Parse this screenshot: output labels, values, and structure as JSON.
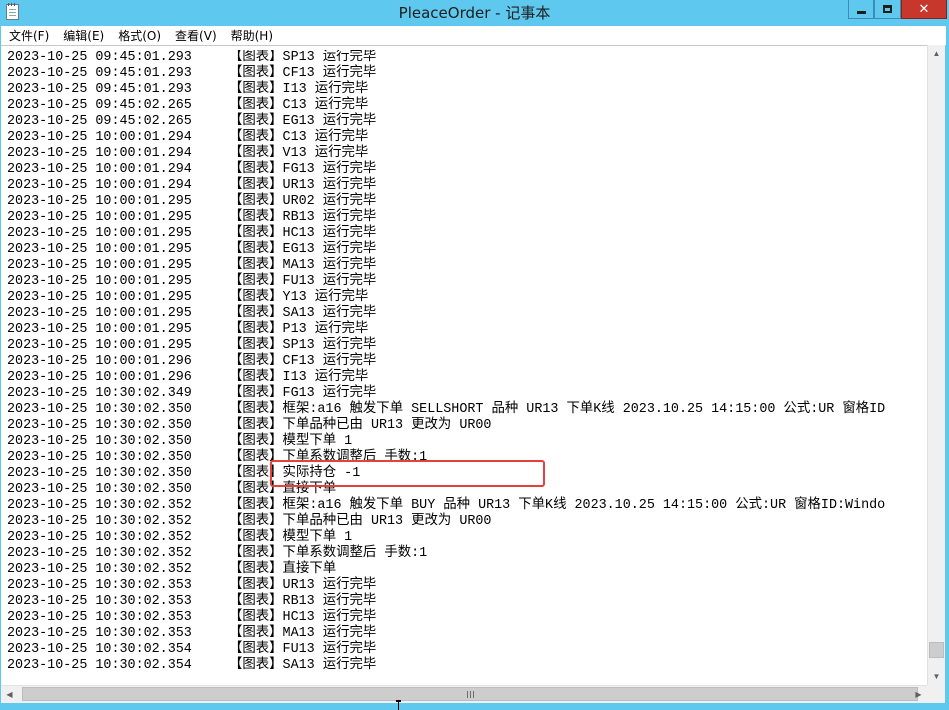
{
  "window": {
    "title": "PleaceOrder - 记事本",
    "icons": {
      "app": "notepad-icon",
      "minimize": "minimize-icon",
      "maximize": "maximize-icon",
      "close": "close-icon"
    }
  },
  "menu": [
    {
      "label": "文件(F)"
    },
    {
      "label": "编辑(E)"
    },
    {
      "label": "格式(O)"
    },
    {
      "label": "查看(V)"
    },
    {
      "label": "帮助(H)"
    }
  ],
  "colors": {
    "titlebar": "#5ec8ee",
    "close": "#c7372c",
    "highlight": "#e3413b"
  },
  "lines": [
    {
      "ts": "2023-10-25 09:45:01.293",
      "msg": "【图表】SP13 运行完毕"
    },
    {
      "ts": "2023-10-25 09:45:01.293",
      "msg": "【图表】CF13 运行完毕"
    },
    {
      "ts": "2023-10-25 09:45:01.293",
      "msg": "【图表】I13 运行完毕"
    },
    {
      "ts": "2023-10-25 09:45:02.265",
      "msg": "【图表】C13 运行完毕"
    },
    {
      "ts": "2023-10-25 09:45:02.265",
      "msg": "【图表】EG13 运行完毕"
    },
    {
      "ts": "2023-10-25 10:00:01.294",
      "msg": "【图表】C13 运行完毕"
    },
    {
      "ts": "2023-10-25 10:00:01.294",
      "msg": "【图表】V13 运行完毕"
    },
    {
      "ts": "2023-10-25 10:00:01.294",
      "msg": "【图表】FG13 运行完毕"
    },
    {
      "ts": "2023-10-25 10:00:01.294",
      "msg": "【图表】UR13 运行完毕"
    },
    {
      "ts": "2023-10-25 10:00:01.295",
      "msg": "【图表】UR02 运行完毕"
    },
    {
      "ts": "2023-10-25 10:00:01.295",
      "msg": "【图表】RB13 运行完毕"
    },
    {
      "ts": "2023-10-25 10:00:01.295",
      "msg": "【图表】HC13 运行完毕"
    },
    {
      "ts": "2023-10-25 10:00:01.295",
      "msg": "【图表】EG13 运行完毕"
    },
    {
      "ts": "2023-10-25 10:00:01.295",
      "msg": "【图表】MA13 运行完毕"
    },
    {
      "ts": "2023-10-25 10:00:01.295",
      "msg": "【图表】FU13 运行完毕"
    },
    {
      "ts": "2023-10-25 10:00:01.295",
      "msg": "【图表】Y13 运行完毕"
    },
    {
      "ts": "2023-10-25 10:00:01.295",
      "msg": "【图表】SA13 运行完毕"
    },
    {
      "ts": "2023-10-25 10:00:01.295",
      "msg": "【图表】P13 运行完毕"
    },
    {
      "ts": "2023-10-25 10:00:01.295",
      "msg": "【图表】SP13 运行完毕"
    },
    {
      "ts": "2023-10-25 10:00:01.296",
      "msg": "【图表】CF13 运行完毕"
    },
    {
      "ts": "2023-10-25 10:00:01.296",
      "msg": "【图表】I13 运行完毕"
    },
    {
      "ts": "2023-10-25 10:30:02.349",
      "msg": "【图表】FG13 运行完毕"
    },
    {
      "ts": "2023-10-25 10:30:02.350",
      "msg": "【图表】框架:a16 触发下单 SELLSHORT 品种 UR13 下单K线 2023.10.25 14:15:00 公式:UR 窗格ID"
    },
    {
      "ts": "2023-10-25 10:30:02.350",
      "msg": "【图表】下单品种已由 UR13 更改为 UR00"
    },
    {
      "ts": "2023-10-25 10:30:02.350",
      "msg": "【图表】模型下单 1"
    },
    {
      "ts": "2023-10-25 10:30:02.350",
      "msg": "【图表】下单系数调整后 手数:1"
    },
    {
      "ts": "2023-10-25 10:30:02.350",
      "msg": "【图表】实际持仓 -1"
    },
    {
      "ts": "2023-10-25 10:30:02.350",
      "msg": "【图表】直接下单"
    },
    {
      "ts": "2023-10-25 10:30:02.352",
      "msg": "【图表】框架:a16 触发下单 BUY 品种 UR13 下单K线 2023.10.25 14:15:00 公式:UR 窗格ID:Windo"
    },
    {
      "ts": "2023-10-25 10:30:02.352",
      "msg": "【图表】下单品种已由 UR13 更改为 UR00"
    },
    {
      "ts": "2023-10-25 10:30:02.352",
      "msg": "【图表】模型下单 1"
    },
    {
      "ts": "2023-10-25 10:30:02.352",
      "msg": "【图表】下单系数调整后 手数:1"
    },
    {
      "ts": "2023-10-25 10:30:02.352",
      "msg": "【图表】直接下单"
    },
    {
      "ts": "2023-10-25 10:30:02.353",
      "msg": "【图表】UR13 运行完毕"
    },
    {
      "ts": "2023-10-25 10:30:02.353",
      "msg": "【图表】RB13 运行完毕"
    },
    {
      "ts": "2023-10-25 10:30:02.353",
      "msg": "【图表】HC13 运行完毕"
    },
    {
      "ts": "2023-10-25 10:30:02.353",
      "msg": "【图表】MA13 运行完毕"
    },
    {
      "ts": "2023-10-25 10:30:02.354",
      "msg": "【图表】FU13 运行完毕"
    },
    {
      "ts": "2023-10-25 10:30:02.354",
      "msg": "【图表】SA13 运行完毕"
    }
  ]
}
